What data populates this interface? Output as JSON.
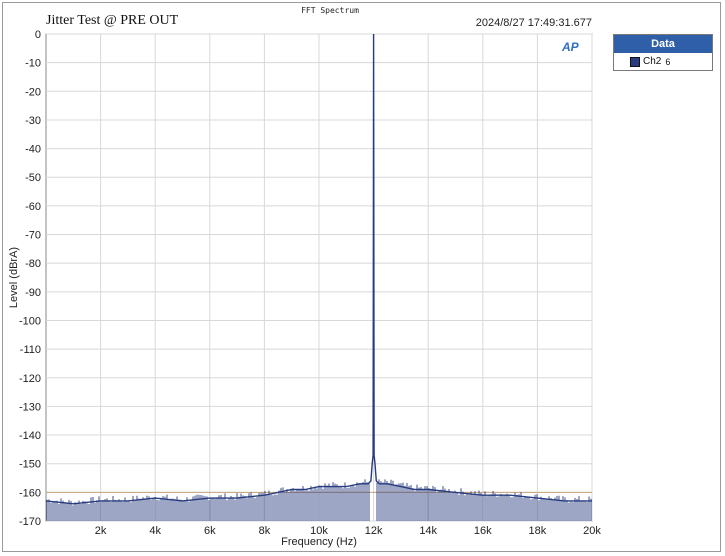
{
  "header": {
    "fft_label": "FFT Spectrum",
    "timestamp": "2024/8/27 17:49:31.677"
  },
  "legend": {
    "title": "Data",
    "entries": [
      {
        "name": "Ch2",
        "number": "6",
        "color": "#283b7e"
      }
    ]
  },
  "logo": "AP",
  "chart_data": {
    "type": "line",
    "title": "Jitter Test @ PRE OUT",
    "xlabel": "Frequency (Hz)",
    "ylabel": "Level (dBrA)",
    "xlim": [
      0,
      20000
    ],
    "ylim": [
      -170,
      0
    ],
    "x_ticks": [
      {
        "value": 2000,
        "label": "2k"
      },
      {
        "value": 4000,
        "label": "4k"
      },
      {
        "value": 6000,
        "label": "6k"
      },
      {
        "value": 8000,
        "label": "8k"
      },
      {
        "value": 10000,
        "label": "10k"
      },
      {
        "value": 12000,
        "label": "12k"
      },
      {
        "value": 14000,
        "label": "14k"
      },
      {
        "value": 16000,
        "label": "16k"
      },
      {
        "value": 18000,
        "label": "18k"
      },
      {
        "value": 20000,
        "label": "20k"
      }
    ],
    "y_ticks": [
      0,
      -10,
      -20,
      -30,
      -40,
      -50,
      -60,
      -70,
      -80,
      -90,
      -100,
      -110,
      -120,
      -130,
      -140,
      -150,
      -160,
      -170
    ],
    "grid": true,
    "reference_line": -160,
    "series": [
      {
        "name": "Ch2",
        "color": "#283b7e",
        "x": [
          0,
          1000,
          2000,
          3000,
          4000,
          5000,
          6000,
          7000,
          8000,
          8500,
          9000,
          9500,
          10000,
          10500,
          11000,
          11500,
          11800,
          11900,
          11950,
          11980,
          12000,
          12020,
          12050,
          12100,
          12200,
          12500,
          13000,
          13500,
          14000,
          15000,
          16000,
          17000,
          18000,
          19000,
          20000
        ],
        "y": [
          -163,
          -164,
          -163,
          -163,
          -162,
          -163,
          -162,
          -162,
          -161,
          -160,
          -159,
          -159,
          -158,
          -158,
          -158,
          -157,
          -157,
          -156,
          -150,
          -147,
          0,
          -147,
          -150,
          -156,
          -157,
          -157,
          -158,
          -159,
          -159,
          -160,
          -161,
          -161,
          -162,
          -163,
          -163
        ]
      }
    ]
  }
}
